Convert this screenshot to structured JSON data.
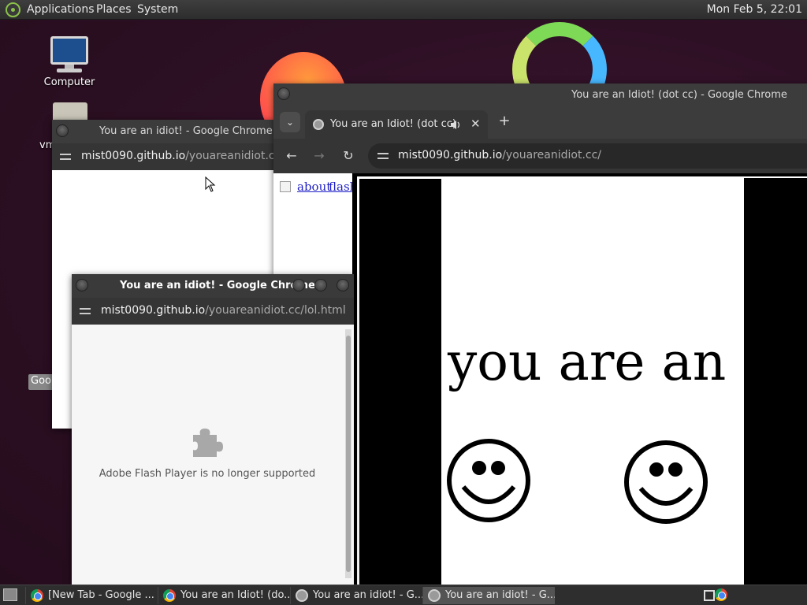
{
  "top_panel": {
    "menus": [
      "Applications",
      "Places",
      "System"
    ],
    "clock": "Mon Feb  5, 22:01"
  },
  "desktop": {
    "computer_label": "Computer",
    "partial_label_vm": "vm",
    "partial_label_goo": "Goo"
  },
  "window_back": {
    "title": "You are an idiot! - Google Chrome",
    "url_domain": "mist0090.github.io",
    "url_path": "/youareanidiot.cc/lol"
  },
  "window_main": {
    "title": "You are an Idiot! (dot cc) - Google Chrome",
    "tab_title": "You are an Idiot! (dot cc)",
    "new_tab": "+",
    "url_domain": "mist0090.github.io",
    "url_path": "/youareanidiot.cc/",
    "links": [
      "about",
      "flash"
    ],
    "banner_text": "you are an idiot"
  },
  "window_front": {
    "title": "You are an idiot! - Google Chrome",
    "url_domain": "mist0090.github.io",
    "url_path": "/youareanidiot.cc/lol.html",
    "message": "Adobe Flash Player is no longer supported"
  },
  "taskbar": {
    "tasks": [
      {
        "label": "[New Tab - Google ...",
        "icon": "chrome-icon"
      },
      {
        "label": "You are an Idiot! (do...",
        "icon": "chrome-icon"
      },
      {
        "label": "You are an idiot! - G...",
        "icon": "globe-icon"
      },
      {
        "label": "You are an idiot! - G...",
        "icon": "globe-icon"
      }
    ]
  }
}
